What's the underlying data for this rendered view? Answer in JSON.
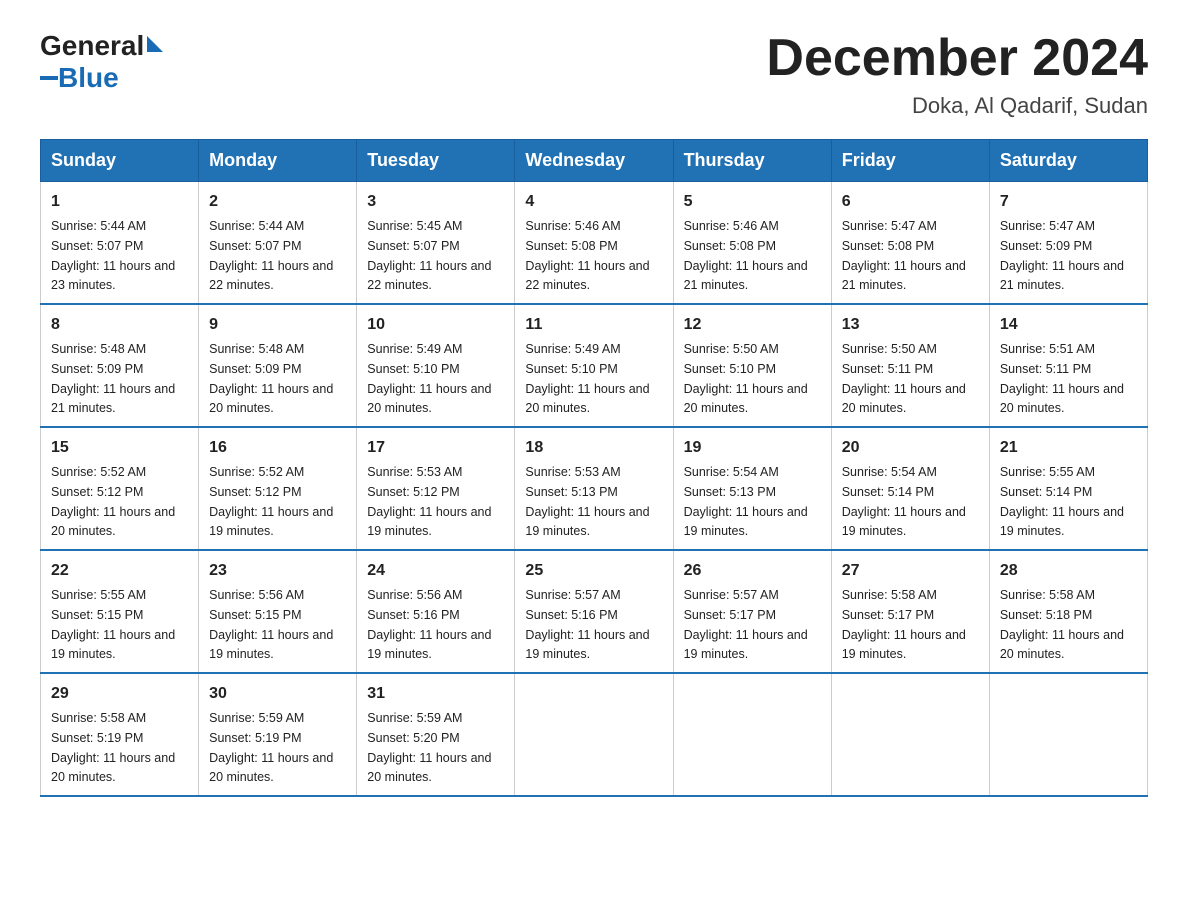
{
  "logo": {
    "general": "General",
    "blue": "Blue"
  },
  "title": "December 2024",
  "subtitle": "Doka, Al Qadarif, Sudan",
  "days_of_week": [
    "Sunday",
    "Monday",
    "Tuesday",
    "Wednesday",
    "Thursday",
    "Friday",
    "Saturday"
  ],
  "weeks": [
    [
      {
        "day": "1",
        "sunrise": "5:44 AM",
        "sunset": "5:07 PM",
        "daylight": "11 hours and 23 minutes."
      },
      {
        "day": "2",
        "sunrise": "5:44 AM",
        "sunset": "5:07 PM",
        "daylight": "11 hours and 22 minutes."
      },
      {
        "day": "3",
        "sunrise": "5:45 AM",
        "sunset": "5:07 PM",
        "daylight": "11 hours and 22 minutes."
      },
      {
        "day": "4",
        "sunrise": "5:46 AM",
        "sunset": "5:08 PM",
        "daylight": "11 hours and 22 minutes."
      },
      {
        "day": "5",
        "sunrise": "5:46 AM",
        "sunset": "5:08 PM",
        "daylight": "11 hours and 21 minutes."
      },
      {
        "day": "6",
        "sunrise": "5:47 AM",
        "sunset": "5:08 PM",
        "daylight": "11 hours and 21 minutes."
      },
      {
        "day": "7",
        "sunrise": "5:47 AM",
        "sunset": "5:09 PM",
        "daylight": "11 hours and 21 minutes."
      }
    ],
    [
      {
        "day": "8",
        "sunrise": "5:48 AM",
        "sunset": "5:09 PM",
        "daylight": "11 hours and 21 minutes."
      },
      {
        "day": "9",
        "sunrise": "5:48 AM",
        "sunset": "5:09 PM",
        "daylight": "11 hours and 20 minutes."
      },
      {
        "day": "10",
        "sunrise": "5:49 AM",
        "sunset": "5:10 PM",
        "daylight": "11 hours and 20 minutes."
      },
      {
        "day": "11",
        "sunrise": "5:49 AM",
        "sunset": "5:10 PM",
        "daylight": "11 hours and 20 minutes."
      },
      {
        "day": "12",
        "sunrise": "5:50 AM",
        "sunset": "5:10 PM",
        "daylight": "11 hours and 20 minutes."
      },
      {
        "day": "13",
        "sunrise": "5:50 AM",
        "sunset": "5:11 PM",
        "daylight": "11 hours and 20 minutes."
      },
      {
        "day": "14",
        "sunrise": "5:51 AM",
        "sunset": "5:11 PM",
        "daylight": "11 hours and 20 minutes."
      }
    ],
    [
      {
        "day": "15",
        "sunrise": "5:52 AM",
        "sunset": "5:12 PM",
        "daylight": "11 hours and 20 minutes."
      },
      {
        "day": "16",
        "sunrise": "5:52 AM",
        "sunset": "5:12 PM",
        "daylight": "11 hours and 19 minutes."
      },
      {
        "day": "17",
        "sunrise": "5:53 AM",
        "sunset": "5:12 PM",
        "daylight": "11 hours and 19 minutes."
      },
      {
        "day": "18",
        "sunrise": "5:53 AM",
        "sunset": "5:13 PM",
        "daylight": "11 hours and 19 minutes."
      },
      {
        "day": "19",
        "sunrise": "5:54 AM",
        "sunset": "5:13 PM",
        "daylight": "11 hours and 19 minutes."
      },
      {
        "day": "20",
        "sunrise": "5:54 AM",
        "sunset": "5:14 PM",
        "daylight": "11 hours and 19 minutes."
      },
      {
        "day": "21",
        "sunrise": "5:55 AM",
        "sunset": "5:14 PM",
        "daylight": "11 hours and 19 minutes."
      }
    ],
    [
      {
        "day": "22",
        "sunrise": "5:55 AM",
        "sunset": "5:15 PM",
        "daylight": "11 hours and 19 minutes."
      },
      {
        "day": "23",
        "sunrise": "5:56 AM",
        "sunset": "5:15 PM",
        "daylight": "11 hours and 19 minutes."
      },
      {
        "day": "24",
        "sunrise": "5:56 AM",
        "sunset": "5:16 PM",
        "daylight": "11 hours and 19 minutes."
      },
      {
        "day": "25",
        "sunrise": "5:57 AM",
        "sunset": "5:16 PM",
        "daylight": "11 hours and 19 minutes."
      },
      {
        "day": "26",
        "sunrise": "5:57 AM",
        "sunset": "5:17 PM",
        "daylight": "11 hours and 19 minutes."
      },
      {
        "day": "27",
        "sunrise": "5:58 AM",
        "sunset": "5:17 PM",
        "daylight": "11 hours and 19 minutes."
      },
      {
        "day": "28",
        "sunrise": "5:58 AM",
        "sunset": "5:18 PM",
        "daylight": "11 hours and 20 minutes."
      }
    ],
    [
      {
        "day": "29",
        "sunrise": "5:58 AM",
        "sunset": "5:19 PM",
        "daylight": "11 hours and 20 minutes."
      },
      {
        "day": "30",
        "sunrise": "5:59 AM",
        "sunset": "5:19 PM",
        "daylight": "11 hours and 20 minutes."
      },
      {
        "day": "31",
        "sunrise": "5:59 AM",
        "sunset": "5:20 PM",
        "daylight": "11 hours and 20 minutes."
      },
      null,
      null,
      null,
      null
    ]
  ],
  "labels": {
    "sunrise": "Sunrise:",
    "sunset": "Sunset:",
    "daylight": "Daylight:"
  }
}
